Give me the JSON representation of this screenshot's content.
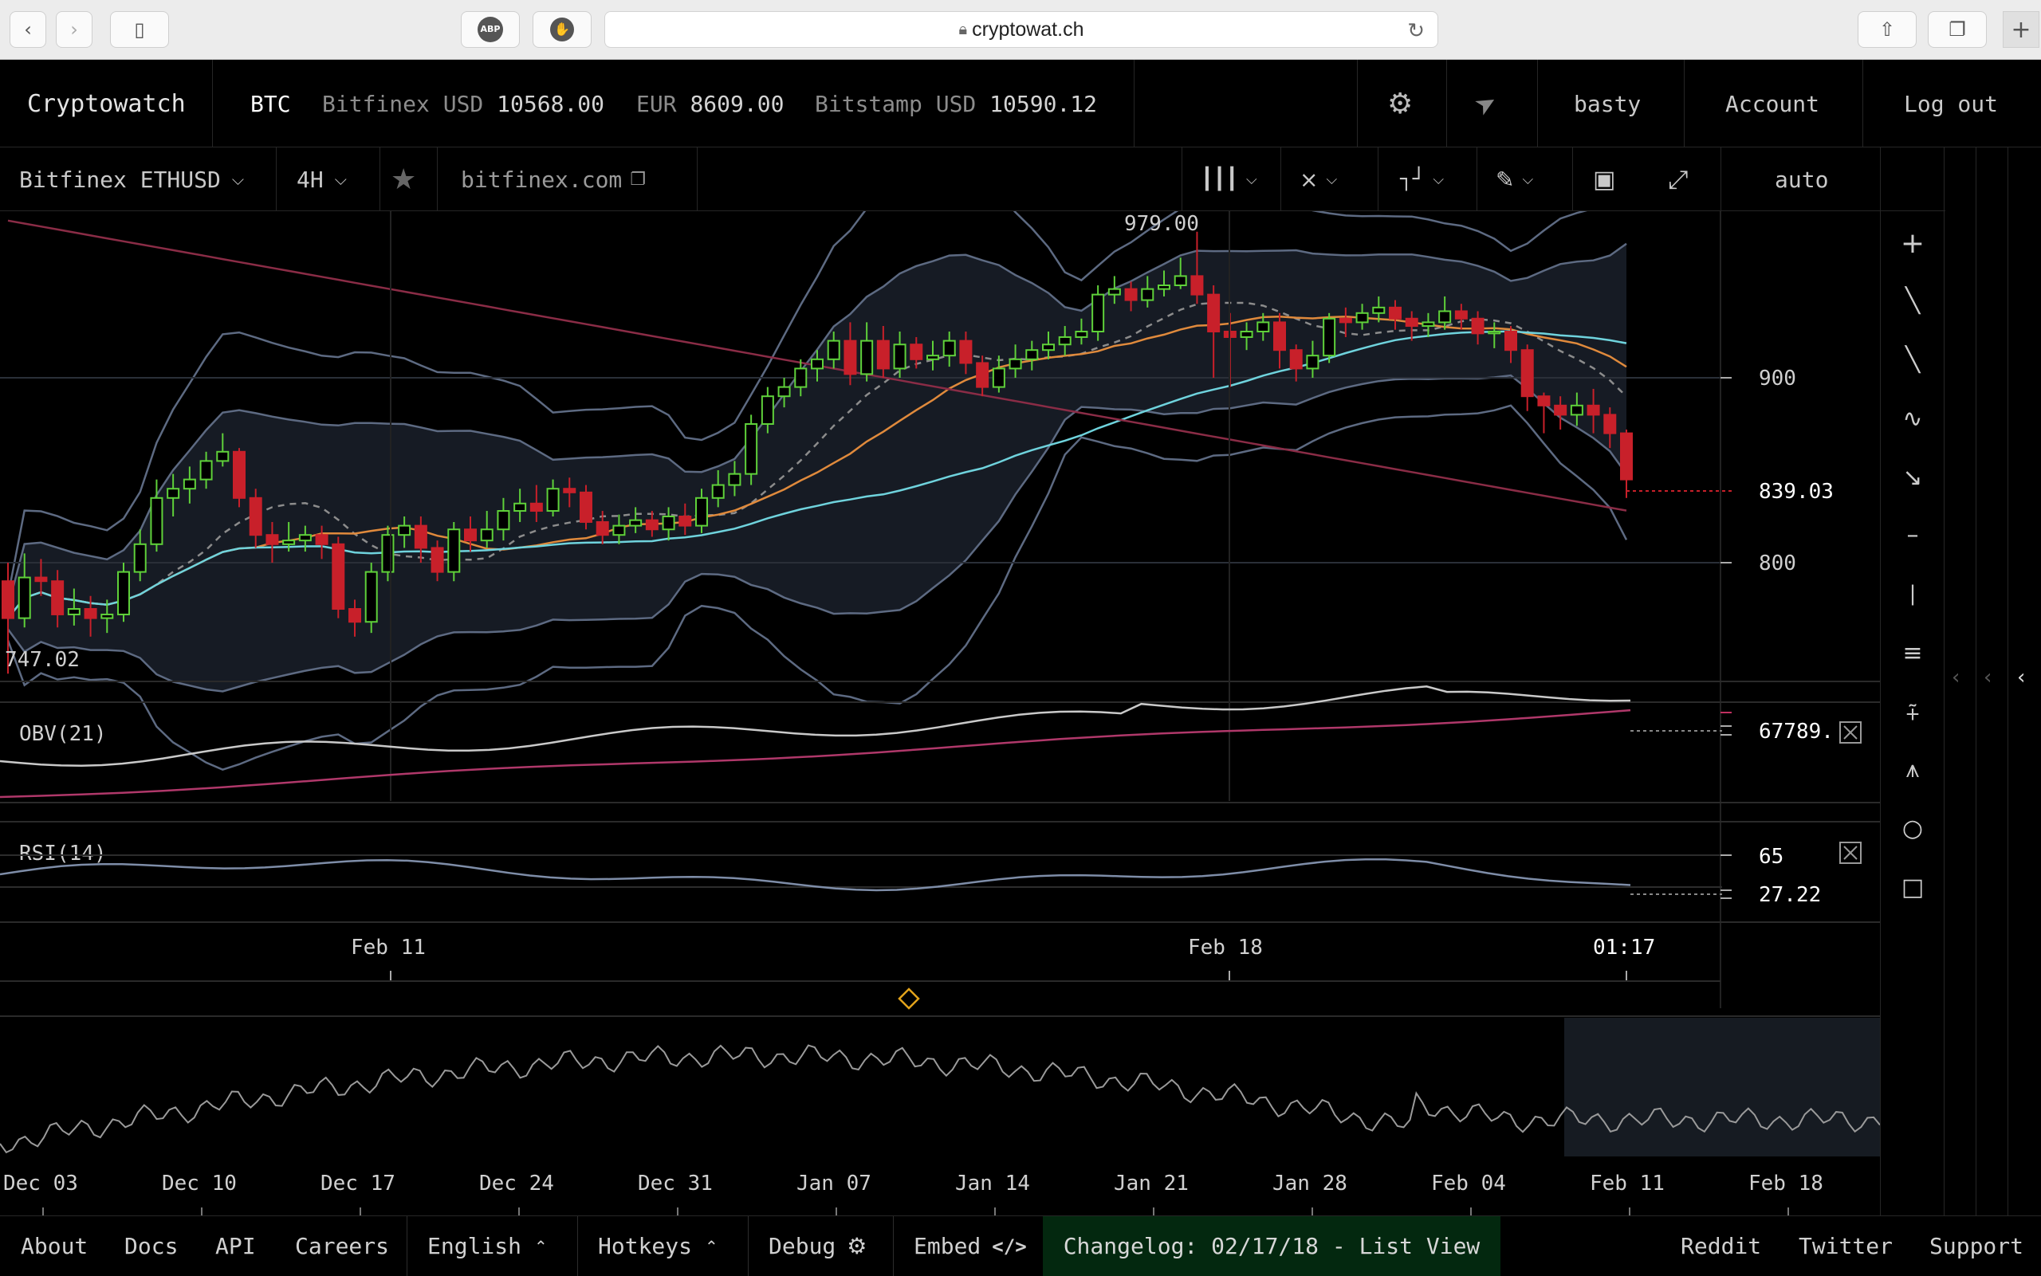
{
  "browser": {
    "url": "cryptowat.ch",
    "ext_abp": "ABP"
  },
  "header": {
    "brand": "Cryptowatch",
    "currency": "BTC",
    "tickers": [
      {
        "exchange": "Bitfinex USD",
        "price": "10568.00"
      },
      {
        "exchange": "EUR",
        "price": "8609.00"
      },
      {
        "exchange": "Bitstamp USD",
        "price": "10590.12"
      }
    ],
    "username": "basty",
    "account_label": "Account",
    "logout_label": "Log out"
  },
  "toolbar": {
    "market": "Bitfinex ETHUSD",
    "period": "4H",
    "exchange_link": "bitfinex.com",
    "scale": "auto"
  },
  "chart": {
    "price_labels": {
      "high": "979.00",
      "low": "747.02",
      "last": "839.03",
      "tick_900": "900",
      "tick_800": "800"
    },
    "obv": {
      "label": "OBV(21)",
      "value": "67789."
    },
    "rsi": {
      "label": "RSI(14)",
      "value_65": "65",
      "value_last": "27.22"
    },
    "time_axis": [
      "Feb 11",
      "Feb 18",
      "01:17"
    ],
    "overview_axis": [
      "Dec 03",
      "Dec 10",
      "Dec 17",
      "Dec 24",
      "Dec 31",
      "Jan 07",
      "Jan 14",
      "Jan 21",
      "Jan 28",
      "Feb 04",
      "Feb 11",
      "Feb 18"
    ]
  },
  "chart_data": {
    "type": "candlestick",
    "pair": "ETHUSD",
    "interval": "4H",
    "y_range": [
      747.02,
      979.0
    ],
    "last_price": 839.03,
    "candles": [
      [
        790,
        770,
        800,
        740
      ],
      [
        770,
        792,
        805,
        765
      ],
      [
        792,
        790,
        802,
        782
      ],
      [
        790,
        772,
        796,
        765
      ],
      [
        772,
        775,
        786,
        766
      ],
      [
        775,
        770,
        782,
        760
      ],
      [
        770,
        772,
        780,
        762
      ],
      [
        772,
        795,
        800,
        768
      ],
      [
        795,
        810,
        818,
        790
      ],
      [
        810,
        835,
        845,
        806
      ],
      [
        835,
        840,
        848,
        825
      ],
      [
        840,
        845,
        852,
        832
      ],
      [
        845,
        855,
        860,
        840
      ],
      [
        855,
        860,
        870,
        852
      ],
      [
        860,
        835,
        862,
        830
      ],
      [
        835,
        815,
        840,
        808
      ],
      [
        815,
        810,
        822,
        800
      ],
      [
        810,
        812,
        822,
        806
      ],
      [
        812,
        815,
        820,
        806
      ],
      [
        815,
        810,
        820,
        802
      ],
      [
        810,
        775,
        814,
        770
      ],
      [
        775,
        768,
        780,
        760
      ],
      [
        768,
        795,
        800,
        762
      ],
      [
        795,
        815,
        820,
        790
      ],
      [
        815,
        820,
        825,
        808
      ],
      [
        820,
        808,
        825,
        800
      ],
      [
        808,
        795,
        812,
        790
      ],
      [
        795,
        818,
        822,
        790
      ],
      [
        818,
        812,
        825,
        806
      ],
      [
        812,
        818,
        828,
        808
      ],
      [
        818,
        828,
        835,
        812
      ],
      [
        828,
        832,
        840,
        822
      ],
      [
        832,
        828,
        842,
        822
      ],
      [
        828,
        840,
        845,
        825
      ],
      [
        840,
        838,
        846,
        830
      ],
      [
        838,
        822,
        842,
        818
      ],
      [
        822,
        815,
        828,
        810
      ],
      [
        815,
        820,
        826,
        810
      ],
      [
        820,
        823,
        830,
        816
      ],
      [
        823,
        818,
        828,
        814
      ],
      [
        818,
        825,
        830,
        812
      ],
      [
        825,
        820,
        832,
        815
      ],
      [
        820,
        835,
        840,
        816
      ],
      [
        835,
        842,
        850,
        830
      ],
      [
        842,
        848,
        855,
        836
      ],
      [
        848,
        875,
        880,
        842
      ],
      [
        875,
        890,
        895,
        870
      ],
      [
        890,
        895,
        900,
        884
      ],
      [
        895,
        905,
        910,
        890
      ],
      [
        905,
        910,
        915,
        898
      ],
      [
        910,
        920,
        925,
        905
      ],
      [
        920,
        902,
        930,
        896
      ],
      [
        902,
        920,
        930,
        898
      ],
      [
        920,
        905,
        928,
        900
      ],
      [
        905,
        918,
        925,
        900
      ],
      [
        918,
        910,
        922,
        905
      ],
      [
        910,
        912,
        920,
        904
      ],
      [
        912,
        920,
        925,
        906
      ],
      [
        920,
        908,
        925,
        902
      ],
      [
        908,
        895,
        912,
        890
      ],
      [
        895,
        905,
        912,
        892
      ],
      [
        905,
        910,
        918,
        900
      ],
      [
        910,
        915,
        920,
        904
      ],
      [
        915,
        918,
        925,
        910
      ],
      [
        918,
        922,
        928,
        912
      ],
      [
        922,
        925,
        932,
        918
      ],
      [
        925,
        945,
        950,
        920
      ],
      [
        945,
        948,
        955,
        940
      ],
      [
        948,
        942,
        952,
        936
      ],
      [
        942,
        948,
        955,
        938
      ],
      [
        948,
        950,
        958,
        944
      ],
      [
        950,
        955,
        965,
        948
      ],
      [
        955,
        945,
        979,
        940
      ],
      [
        945,
        925,
        950,
        900
      ],
      [
        925,
        922,
        935,
        895
      ],
      [
        922,
        925,
        930,
        915
      ],
      [
        925,
        930,
        935,
        920
      ],
      [
        930,
        915,
        935,
        905
      ],
      [
        915,
        905,
        918,
        898
      ],
      [
        905,
        912,
        920,
        900
      ],
      [
        912,
        932,
        935,
        908
      ],
      [
        932,
        930,
        938,
        922
      ],
      [
        930,
        935,
        940,
        926
      ],
      [
        935,
        938,
        944,
        930
      ],
      [
        938,
        932,
        942,
        926
      ],
      [
        932,
        928,
        936,
        920
      ],
      [
        928,
        930,
        935,
        922
      ],
      [
        930,
        936,
        944,
        926
      ],
      [
        936,
        932,
        940,
        926
      ],
      [
        932,
        924,
        936,
        918
      ],
      [
        924,
        925,
        930,
        916
      ],
      [
        925,
        915,
        928,
        908
      ],
      [
        915,
        890,
        918,
        882
      ],
      [
        890,
        885,
        892,
        870
      ],
      [
        885,
        880,
        890,
        872
      ],
      [
        880,
        885,
        892,
        874
      ],
      [
        885,
        880,
        894,
        870
      ],
      [
        880,
        870,
        884,
        862
      ],
      [
        870,
        845,
        872,
        835
      ]
    ],
    "indicators": [
      "OBV(21)",
      "RSI(14)"
    ],
    "rsi_last": 27.22,
    "obv_last": 67789
  }
}
